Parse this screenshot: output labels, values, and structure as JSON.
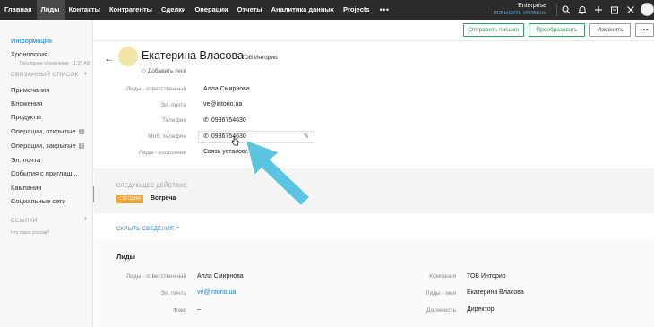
{
  "nav": {
    "items": [
      "Главная",
      "Лиды",
      "Контакты",
      "Контрагенты",
      "Сделки",
      "Операции",
      "Отчеты",
      "Аналитика данных",
      "Projects"
    ],
    "active_index": 1,
    "more": "•••",
    "plan_name": "Enterprise",
    "plan_upgrade": "ПОВЫСИТЬ УРОВЕНЬ"
  },
  "sidebar": {
    "info": "Информация",
    "timeline": "Хронология",
    "timeline_sub": "Последнее обновление",
    "timeline_time": "11:37 AM",
    "related_header": "СВЯЗАННЫЙ СПИСОК",
    "items": [
      "Примечания",
      "Вложения",
      "Продукты",
      "Операции, открытые",
      "Операции, закрытые",
      "Эл. почта",
      "События с приглаш...",
      "Кампании",
      "Социальные сети"
    ],
    "badges": {
      "open": "1",
      "closed": "0"
    },
    "links_header": "ССЫЛКИ",
    "links_sub": "Что такое ссылки?"
  },
  "actions": {
    "send_email": "Отправить письмо",
    "convert": "Преобразовать",
    "edit": "Изменить",
    "more": "•••"
  },
  "contact": {
    "name": "Екатерина Власова",
    "company_sep": "•",
    "company": "ТОВ Инторио",
    "add_tags": "Добавить теги"
  },
  "fields": [
    {
      "label": "Лиды - ответственный",
      "value": "Алла Смирнова"
    },
    {
      "label": "Эл. почта",
      "value": "ve@intorio.ua"
    },
    {
      "label": "Телефон",
      "value": "0936754630"
    },
    {
      "label": "Моб. телефон",
      "value": "0936754630"
    },
    {
      "label": "Лиды - состояние",
      "value": "Связь установлена"
    }
  ],
  "next_action": {
    "title": "СЛЕДУЮЩЕЕ ДЕЙСТВИЕ",
    "badge": "СЕГОДНЯ",
    "event": "Встреча"
  },
  "hide_details": "СКРЫТЬ СВЕДЕНИЯ",
  "details": {
    "title": "Лиды",
    "left": [
      {
        "label": "Лиды - ответственный",
        "value": "Алла Смирнова"
      },
      {
        "label": "Эл. почта",
        "value": "ve@intorio.ua"
      },
      {
        "label": "Факс",
        "value": "–"
      }
    ],
    "right": [
      {
        "label": "Компания",
        "value": "ТОВ Инторио"
      },
      {
        "label": "Лиды - имя",
        "value": "Екатерина Власова"
      },
      {
        "label": "Должность",
        "value": "Директор"
      }
    ]
  },
  "colors": {
    "nav_bg": "#2b2b2b",
    "accent_green": "#2ba35b",
    "link_blue": "#1a7cc7",
    "today_orange": "#f2a633",
    "arrow_cyan": "#5bc4e0"
  }
}
